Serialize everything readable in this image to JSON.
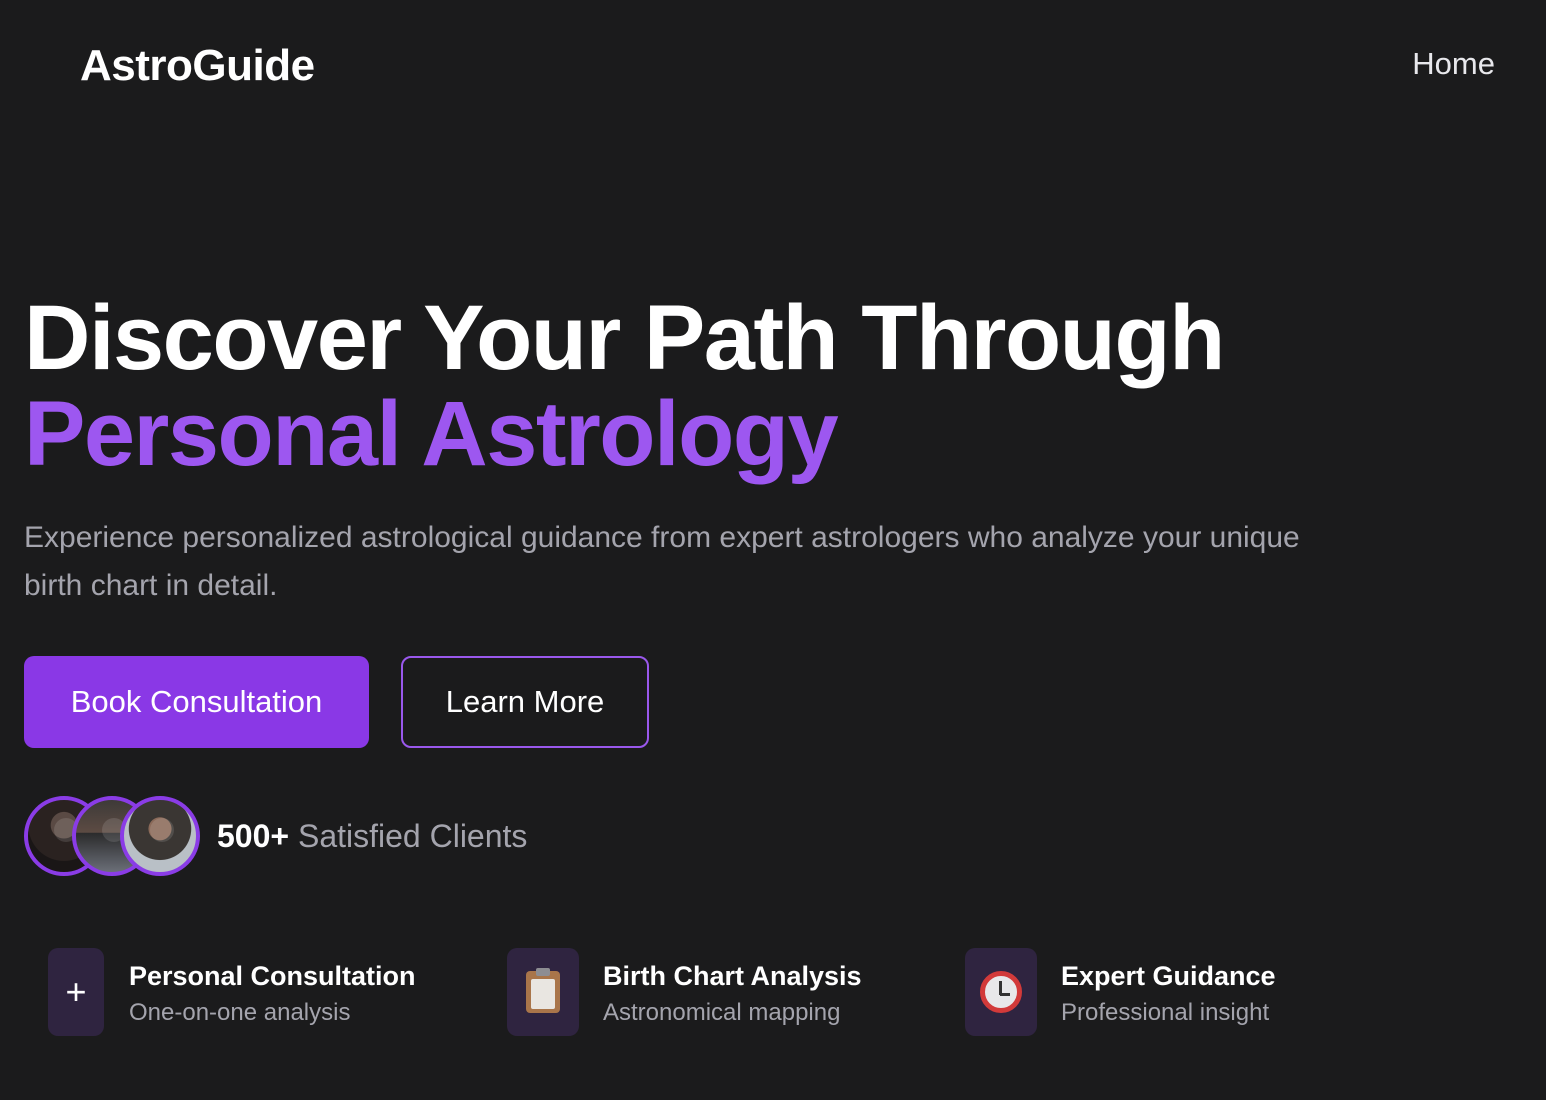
{
  "header": {
    "logo": "AstroGuide",
    "nav": {
      "home": "Home"
    }
  },
  "hero": {
    "title_line1": "Discover Your Path Through",
    "title_line2": "Personal Astrology",
    "subtitle": "Experience personalized astrological guidance from expert astrologers who analyze your unique birth chart in detail.",
    "primary_button": "Book Consultation",
    "secondary_button": "Learn More"
  },
  "social_proof": {
    "count": "500+",
    "label": "Satisfied Clients"
  },
  "features": [
    {
      "icon": "plus-icon",
      "title": "Personal Consultation",
      "description": "One-on-one analysis",
      "icon_glyph": "+"
    },
    {
      "icon": "clipboard-icon",
      "title": "Birth Chart Analysis",
      "description": "Astronomical mapping"
    },
    {
      "icon": "alarm-clock-icon",
      "title": "Expert Guidance",
      "description": "Professional insight"
    }
  ],
  "colors": {
    "background": "#1b1b1c",
    "accent": "#8a38e6",
    "accent_text": "#9d57f0",
    "muted_text": "#a4a4ad",
    "tile_bg": "#2f2440"
  }
}
